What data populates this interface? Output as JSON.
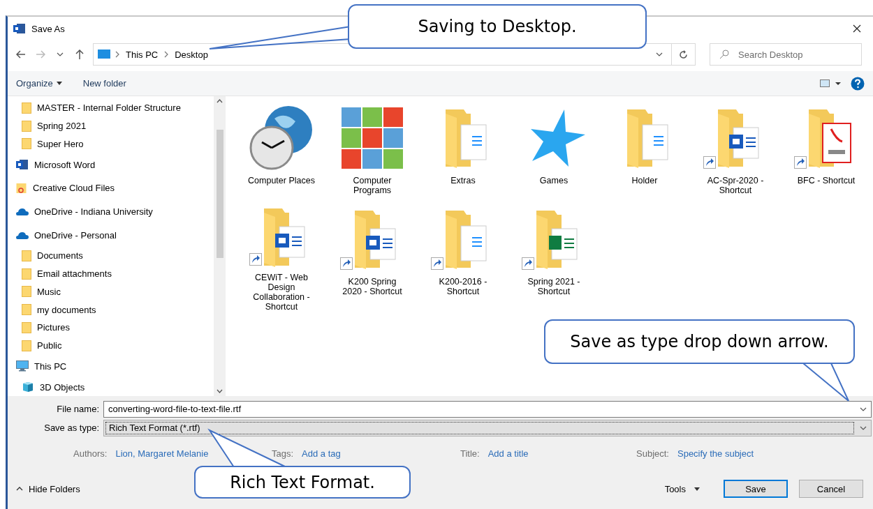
{
  "window": {
    "title": "Save As"
  },
  "address": {
    "path": [
      "This PC",
      "Desktop"
    ]
  },
  "search": {
    "placeholder": "Search Desktop"
  },
  "toolbar": [
    {
      "label": "Organize",
      "kind": "menu"
    },
    {
      "label": "New folder",
      "kind": "plain"
    }
  ],
  "sidebar": {
    "continued_children": [
      {
        "label": "MASTER - Internal Folder Structure",
        "kind": "folder"
      },
      {
        "label": "Spring 2021",
        "kind": "folder"
      },
      {
        "label": "Super Hero",
        "kind": "folder"
      }
    ],
    "items": [
      {
        "label": "Microsoft Word",
        "kind": "word"
      },
      {
        "label": "Creative Cloud Files",
        "kind": "cc"
      },
      {
        "label": "OneDrive - Indiana University",
        "kind": "cloud"
      },
      {
        "label": "OneDrive - Personal",
        "kind": "cloud",
        "children": [
          {
            "label": "Documents",
            "kind": "folder"
          },
          {
            "label": "Email attachments",
            "kind": "folder"
          },
          {
            "label": "Music",
            "kind": "folder"
          },
          {
            "label": "my documents",
            "kind": "folder"
          },
          {
            "label": "Pictures",
            "kind": "folder"
          },
          {
            "label": "Public",
            "kind": "folder"
          }
        ]
      },
      {
        "label": "This PC",
        "kind": "pc",
        "children": [
          {
            "label": "3D Objects",
            "kind": "cube"
          }
        ]
      }
    ]
  },
  "files": [
    {
      "label": "Computer Places",
      "kind": "places",
      "shortcut": false
    },
    {
      "label": "Computer Programs",
      "kind": "programs",
      "shortcut": false
    },
    {
      "label": "Extras",
      "kind": "folder",
      "shortcut": false
    },
    {
      "label": "Games",
      "kind": "games",
      "shortcut": false
    },
    {
      "label": "Holder",
      "kind": "folder",
      "shortcut": false
    },
    {
      "label": "AC-Spr-2020 - Shortcut",
      "kind": "word-folder",
      "shortcut": true
    },
    {
      "label": "BFC - Shortcut",
      "kind": "pdf-folder",
      "shortcut": true
    },
    {
      "label": "CEWiT - Web Design Collaboration - Shortcut",
      "kind": "word-folder",
      "shortcut": true
    },
    {
      "label": "K200 Spring 2020 - Shortcut",
      "kind": "word-folder",
      "shortcut": true
    },
    {
      "label": "K200-2016 - Shortcut",
      "kind": "folder",
      "shortcut": true
    },
    {
      "label": "Spring 2021 - Shortcut",
      "kind": "excel-folder",
      "shortcut": true
    }
  ],
  "file_name": {
    "label": "File name:",
    "value": "converting-word-file-to-text-file.rtf"
  },
  "save_as_type": {
    "label": "Save as type:",
    "value": "Rich Text Format (*.rtf)"
  },
  "metadata": [
    {
      "label": "Authors:",
      "value": "Lion, Margaret Melanie"
    },
    {
      "label": "Tags:",
      "value": "Add a tag"
    },
    {
      "label": "Title:",
      "value": "Add a title"
    },
    {
      "label": "Subject:",
      "value": "Specify the subject"
    }
  ],
  "hide_folders": {
    "label": "Hide Folders"
  },
  "tools": {
    "label": "Tools"
  },
  "buttons": [
    {
      "label": "Save",
      "kind": "default"
    },
    {
      "label": "Cancel",
      "kind": "normal"
    }
  ],
  "callouts": [
    {
      "text": "Saving to Desktop."
    },
    {
      "text": "Save as type drop down arrow."
    },
    {
      "text": "Rich Text Format."
    }
  ]
}
